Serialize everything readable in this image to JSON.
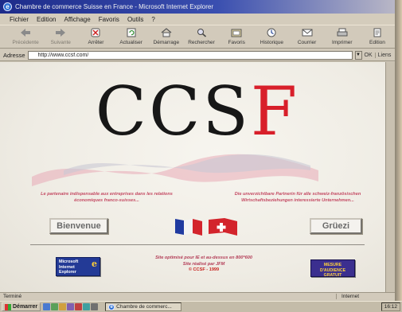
{
  "window": {
    "title": "Chambre de commerce Suisse en France - Microsoft Internet Explorer"
  },
  "menu": [
    "Fichier",
    "Edition",
    "Affichage",
    "Favoris",
    "Outils",
    "?"
  ],
  "toolbar": {
    "buttons": [
      {
        "label": "Précédente",
        "icon": "back-arrow-icon"
      },
      {
        "label": "Suivante",
        "icon": "forward-arrow-icon"
      },
      {
        "label": "Arrêter",
        "icon": "stop-icon"
      },
      {
        "label": "Actualiser",
        "icon": "refresh-icon"
      },
      {
        "label": "Démarrage",
        "icon": "home-icon"
      },
      {
        "label": "Rechercher",
        "icon": "search-icon"
      },
      {
        "label": "Favoris",
        "icon": "favorites-icon"
      },
      {
        "label": "Historique",
        "icon": "history-icon"
      },
      {
        "label": "Courrier",
        "icon": "mail-icon"
      },
      {
        "label": "Imprimer",
        "icon": "print-icon"
      },
      {
        "label": "Edition",
        "icon": "edit-icon"
      }
    ]
  },
  "address": {
    "label": "Adresse",
    "url": "http://www.ccsf.com/",
    "go": "OK",
    "links": "Liens"
  },
  "page": {
    "logo_left": "CCS",
    "logo_right": "F",
    "partner_fr": "Le partenaire indispensable aux entreprises dans les relations économiques franco-suisses...",
    "partner_de": "Die unverzichtbare Partnerin für alle schweiz-französischen Wirtschaftsbeziehungen interessierte Unternehmen...",
    "btn_fr": "Bienvenue",
    "btn_de": "Grüezi",
    "ie_badge": [
      "Microsoft",
      "Internet",
      "Explorer"
    ],
    "ie_badge_letter": "e",
    "credits_1": "Site optimisé pour IE et au-dessus en 800*600",
    "credits_2": "Site réalisé par JFM",
    "credits_3": "© CCSF - 1999",
    "audience_badge": [
      "MESURE",
      "D'AUDIENCE",
      "GRATUIT"
    ]
  },
  "status": {
    "left": "Terminé",
    "zone": "Internet"
  },
  "taskbar": {
    "start": "Démarrer",
    "task": "Chambre de commerc...",
    "tray": "16:12"
  },
  "colors": {
    "logo_red": "#d81f2a",
    "logo_black": "#171717",
    "title_blue": "#1d2b8a",
    "accent_pink": "#c44a63"
  }
}
